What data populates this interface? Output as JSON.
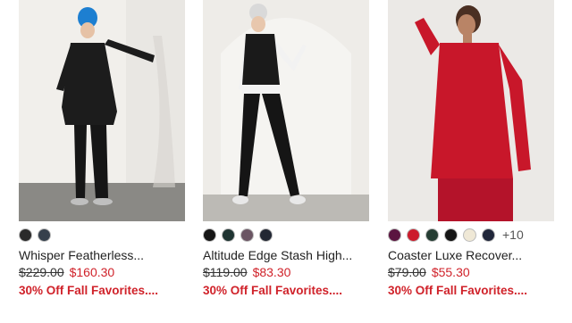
{
  "products": [
    {
      "name": "Whisper Featherless...",
      "original_price": "$229.00",
      "sale_price": "$160.30",
      "promo": "30% Off Fall Favorites....",
      "swatches": [
        "#2a2a2a",
        "#36404c"
      ],
      "more_colors": ""
    },
    {
      "name": "Altitude Edge Stash High...",
      "original_price": "$119.00",
      "sale_price": "$83.30",
      "promo": "30% Off Fall Favorites....",
      "swatches": [
        "#161616",
        "#1f3432",
        "#6a5563",
        "#222733"
      ],
      "more_colors": ""
    },
    {
      "name": "Coaster Luxe Recover...",
      "original_price": "$79.00",
      "sale_price": "$55.30",
      "promo": "30% Off Fall Favorites....",
      "swatches": [
        "#5b1540",
        "#cc1c2c",
        "#253d33",
        "#151515",
        "#efe8d6",
        "#20263a"
      ],
      "more_colors": "+10"
    }
  ]
}
